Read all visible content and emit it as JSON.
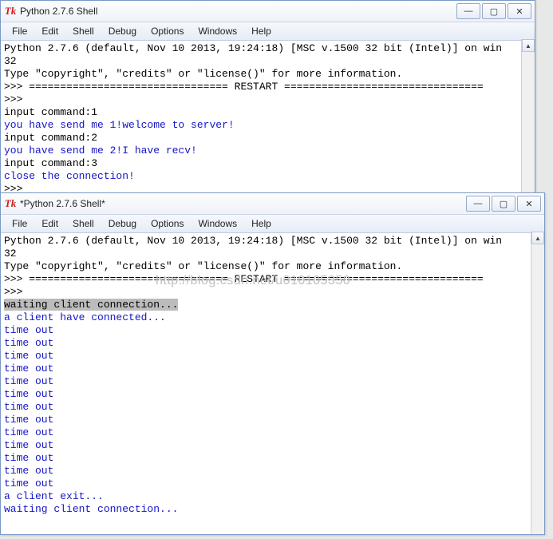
{
  "watermark": "http://blog.csdn.net/u010105350",
  "top": {
    "title": "Python 2.7.6 Shell",
    "menu": [
      "File",
      "Edit",
      "Shell",
      "Debug",
      "Options",
      "Windows",
      "Help"
    ],
    "lines": [
      {
        "cls": "black",
        "text": "Python 2.7.6 (default, Nov 10 2013, 19:24:18) [MSC v.1500 32 bit (Intel)] on win"
      },
      {
        "cls": "black",
        "text": "32"
      },
      {
        "cls": "black",
        "text": "Type \"copyright\", \"credits\" or \"license()\" for more information."
      },
      {
        "cls": "prompt",
        "text": ">>> ================================ RESTART ================================"
      },
      {
        "cls": "prompt",
        "text": ">>> "
      },
      {
        "cls": "black",
        "text": "input command:1"
      },
      {
        "cls": "blue",
        "text": "you have send me 1!welcome to server!"
      },
      {
        "cls": "black",
        "text": "input command:2"
      },
      {
        "cls": "blue",
        "text": "you have send me 2!I have recv!"
      },
      {
        "cls": "black",
        "text": "input command:3"
      },
      {
        "cls": "blue",
        "text": "close the connection!"
      },
      {
        "cls": "prompt",
        "text": ">>> "
      }
    ]
  },
  "bottom": {
    "title": "*Python 2.7.6 Shell*",
    "menu": [
      "File",
      "Edit",
      "Shell",
      "Debug",
      "Options",
      "Windows",
      "Help"
    ],
    "lines": [
      {
        "cls": "black",
        "text": "Python 2.7.6 (default, Nov 10 2013, 19:24:18) [MSC v.1500 32 bit (Intel)] on win"
      },
      {
        "cls": "black",
        "text": "32"
      },
      {
        "cls": "black",
        "text": "Type \"copyright\", \"credits\" or \"license()\" for more information."
      },
      {
        "cls": "prompt",
        "text": ">>> ================================ RESTART ================================"
      },
      {
        "cls": "prompt",
        "text": ">>> "
      },
      {
        "cls": "highlight",
        "text": "waiting client connection..."
      },
      {
        "cls": "blue",
        "text": "a client have connected..."
      },
      {
        "cls": "blue",
        "text": "time out"
      },
      {
        "cls": "blue",
        "text": "time out"
      },
      {
        "cls": "blue",
        "text": "time out"
      },
      {
        "cls": "blue",
        "text": "time out"
      },
      {
        "cls": "blue",
        "text": "time out"
      },
      {
        "cls": "blue",
        "text": "time out"
      },
      {
        "cls": "blue",
        "text": "time out"
      },
      {
        "cls": "blue",
        "text": "time out"
      },
      {
        "cls": "blue",
        "text": "time out"
      },
      {
        "cls": "blue",
        "text": "time out"
      },
      {
        "cls": "blue",
        "text": "time out"
      },
      {
        "cls": "blue",
        "text": "time out"
      },
      {
        "cls": "blue",
        "text": "time out"
      },
      {
        "cls": "blue",
        "text": "a client exit..."
      },
      {
        "cls": "blue",
        "text": "waiting client connection..."
      }
    ]
  },
  "winbtn": {
    "min": "—",
    "max": "▢",
    "close": "✕"
  },
  "scroll": {
    "up": "▲",
    "down": "▼"
  }
}
